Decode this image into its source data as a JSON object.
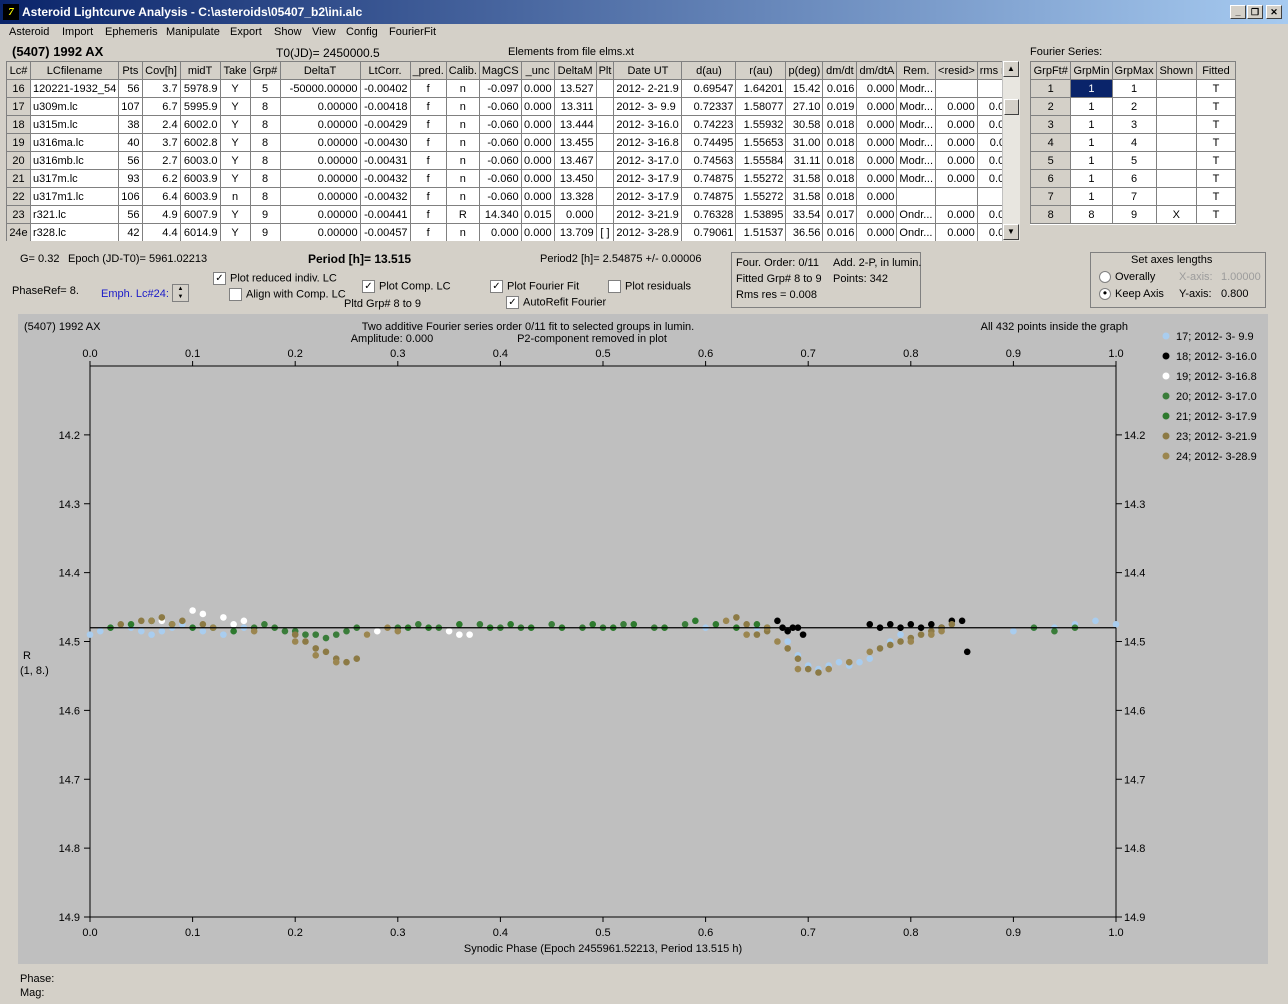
{
  "window": {
    "title": "Asteroid Lightcurve Analysis - C:\\asteroids\\05407_b2\\ini.alc"
  },
  "menu": [
    "Asteroid",
    "Import",
    "Ephemeris",
    "Manipulate",
    "Export",
    "Show",
    "View",
    "Config",
    "FourierFit"
  ],
  "header": {
    "asteroid": "(5407) 1992 AX",
    "t0": "T0(JD)= 2450000.5",
    "elements": "Elements from file elms.xt",
    "fourier_series": "Fourier Series:"
  },
  "lc_table": {
    "columns": [
      "Lc#",
      "LCfilename",
      "Pts",
      "Cov[h]",
      "midT",
      "Take",
      "Grp#",
      "DeltaT",
      "LtCorr.",
      "_pred.",
      "Calib.",
      "MagCS",
      "_unc",
      "DeltaM",
      "Plt",
      "Date UT",
      "d(au)",
      "r(au)",
      "p(deg)",
      "dm/dt",
      "dm/dtA",
      "Rem.",
      "<resid>",
      "rms res"
    ],
    "rows": [
      [
        "16",
        "120221-1932_54",
        "56",
        "3.7",
        "5978.9",
        "Y",
        "5",
        "-50000.00000",
        "-0.00402",
        "f",
        "n",
        "-0.097",
        "0.000",
        "13.527",
        "",
        "2012- 2-21.9",
        "0.69547",
        "1.64201",
        "15.42",
        "0.016",
        "0.000",
        "Modr...",
        "",
        ""
      ],
      [
        "17",
        "u309m.lc",
        "107",
        "6.7",
        "5995.9",
        "Y",
        "8",
        "0.00000",
        "-0.00418",
        "f",
        "n",
        "-0.060",
        "0.000",
        "13.311",
        "",
        "2012- 3- 9.9",
        "0.72337",
        "1.58077",
        "27.10",
        "0.019",
        "0.000",
        "Modr...",
        "0.000",
        "0.009"
      ],
      [
        "18",
        "u315m.lc",
        "38",
        "2.4",
        "6002.0",
        "Y",
        "8",
        "0.00000",
        "-0.00429",
        "f",
        "n",
        "-0.060",
        "0.000",
        "13.444",
        "",
        "2012- 3-16.0",
        "0.74223",
        "1.55932",
        "30.58",
        "0.018",
        "0.000",
        "Modr...",
        "0.000",
        "0.006"
      ],
      [
        "19",
        "u316ma.lc",
        "40",
        "3.7",
        "6002.8",
        "Y",
        "8",
        "0.00000",
        "-0.00430",
        "f",
        "n",
        "-0.060",
        "0.000",
        "13.455",
        "",
        "2012- 3-16.8",
        "0.74495",
        "1.55653",
        "31.00",
        "0.018",
        "0.000",
        "Modr...",
        "0.000",
        "0.011"
      ],
      [
        "20",
        "u316mb.lc",
        "56",
        "2.7",
        "6003.0",
        "Y",
        "8",
        "0.00000",
        "-0.00431",
        "f",
        "n",
        "-0.060",
        "0.000",
        "13.467",
        "",
        "2012- 3-17.0",
        "0.74563",
        "1.55584",
        "31.11",
        "0.018",
        "0.000",
        "Modr...",
        "0.000",
        "0.006"
      ],
      [
        "21",
        "u317m.lc",
        "93",
        "6.2",
        "6003.9",
        "Y",
        "8",
        "0.00000",
        "-0.00432",
        "f",
        "n",
        "-0.060",
        "0.000",
        "13.450",
        "",
        "2012- 3-17.9",
        "0.74875",
        "1.55272",
        "31.58",
        "0.018",
        "0.000",
        "Modr...",
        "0.000",
        "0.006"
      ],
      [
        "22",
        "u317m1.lc",
        "106",
        "6.4",
        "6003.9",
        "n",
        "8",
        "0.00000",
        "-0.00432",
        "f",
        "n",
        "-0.060",
        "0.000",
        "13.328",
        "",
        "2012- 3-17.9",
        "0.74875",
        "1.55272",
        "31.58",
        "0.018",
        "0.000",
        "",
        "",
        ""
      ],
      [
        "23",
        "r321.lc",
        "56",
        "4.9",
        "6007.9",
        "Y",
        "9",
        "0.00000",
        "-0.00441",
        "f",
        "R",
        "14.340",
        "0.015",
        "0.000",
        "",
        "2012- 3-21.9",
        "0.76328",
        "1.53895",
        "33.54",
        "0.017",
        "0.000",
        "Ondr...",
        "0.000",
        "0.010"
      ],
      [
        "24e",
        "r328.lc",
        "42",
        "4.4",
        "6014.9",
        "Y",
        "9",
        "0.00000",
        "-0.00457",
        "f",
        "n",
        "0.000",
        "0.000",
        "13.709",
        "[ ]",
        "2012- 3-28.9",
        "0.79061",
        "1.51537",
        "36.56",
        "0.016",
        "0.000",
        "Ondr...",
        "0.000",
        "0.010"
      ]
    ]
  },
  "fourier_table": {
    "columns": [
      "GrpFt#",
      "GrpMin",
      "GrpMax",
      "Shown",
      "Fitted"
    ],
    "rows": [
      [
        "1",
        "1",
        "1",
        "",
        "T"
      ],
      [
        "2",
        "1",
        "2",
        "",
        "T"
      ],
      [
        "3",
        "1",
        "3",
        "",
        "T"
      ],
      [
        "4",
        "1",
        "4",
        "",
        "T"
      ],
      [
        "5",
        "1",
        "5",
        "",
        "T"
      ],
      [
        "6",
        "1",
        "6",
        "",
        "T"
      ],
      [
        "7",
        "1",
        "7",
        "",
        "T"
      ],
      [
        "8",
        "8",
        "9",
        "X",
        "T"
      ]
    ]
  },
  "controls": {
    "g": "G= 0.32",
    "epoch": "Epoch (JD-T0)= 5961.02213",
    "period": "Period [h]= 13.515",
    "period2": "Period2 [h]= 2.54875 +/- 0.00006",
    "phaseref": "PhaseRef= 8.",
    "emph": "Emph. Lc#24:",
    "plot_reduced": "Plot reduced indiv. LC",
    "align_comp": "Align with Comp. LC",
    "plot_comp": "Plot Comp. LC",
    "pltd_grp": "Pltd Grp#  8  to   9",
    "plot_fourier": "Plot Fourier Fit",
    "autorefit": "AutoRefit Fourier",
    "plot_residuals": "Plot residuals",
    "four_order": "Four. Order:  0/11",
    "add2p": "Add. 2-P, in lumin.",
    "fitted_grp": "Fitted Grp# 8 to 9",
    "points": "Points: 342",
    "rms_res": "Rms res     = 0.008"
  },
  "axes_box": {
    "title": "Set axes lengths",
    "overally": "Overally",
    "keep_axis": "Keep Axis",
    "xaxis_label": "X-axis:",
    "xaxis_value": "1.00000",
    "yaxis_label": "Y-axis:",
    "yaxis_value": "0.800"
  },
  "chart_data": {
    "type": "scatter",
    "object_label": "(5407) 1992 AX",
    "title": "Two additive Fourier series order 0/11 fit to selected groups in lumin.",
    "subtitle_left": "Amplitude: 0.000",
    "subtitle_right": "P2-component removed in plot",
    "info": "All 432 points inside the graph",
    "xlabel": "Synodic Phase (Epoch 2455961.52213, Period 13.515 h)",
    "ylabel": "R",
    "ylabel2": "(1, 8.)",
    "xlim": [
      0.0,
      1.0
    ],
    "ylim": [
      14.1,
      14.9
    ],
    "y_inverted": true,
    "xticks": [
      "0.0",
      "0.1",
      "0.2",
      "0.3",
      "0.4",
      "0.5",
      "0.6",
      "0.7",
      "0.8",
      "0.9",
      "1.0"
    ],
    "yticks": [
      "14.2",
      "14.3",
      "14.4",
      "14.5",
      "14.6",
      "14.7",
      "14.8",
      "14.9"
    ],
    "fit_line": 14.48,
    "series": [
      {
        "name": "17; 2012- 3- 9.9",
        "color": "#a9cdef",
        "points": [
          [
            0.0,
            14.49
          ],
          [
            0.01,
            14.485
          ],
          [
            0.02,
            14.48
          ],
          [
            0.03,
            14.475
          ],
          [
            0.04,
            14.48
          ],
          [
            0.05,
            14.485
          ],
          [
            0.06,
            14.49
          ],
          [
            0.07,
            14.485
          ],
          [
            0.08,
            14.48
          ],
          [
            0.09,
            14.475
          ],
          [
            0.1,
            14.48
          ],
          [
            0.11,
            14.485
          ],
          [
            0.12,
            14.48
          ],
          [
            0.13,
            14.49
          ],
          [
            0.14,
            14.485
          ],
          [
            0.15,
            14.48
          ],
          [
            0.6,
            14.48
          ],
          [
            0.65,
            14.48
          ],
          [
            0.68,
            14.5
          ],
          [
            0.69,
            14.52
          ],
          [
            0.7,
            14.535
          ],
          [
            0.71,
            14.54
          ],
          [
            0.72,
            14.535
          ],
          [
            0.73,
            14.53
          ],
          [
            0.74,
            14.535
          ],
          [
            0.75,
            14.53
          ],
          [
            0.76,
            14.525
          ],
          [
            0.77,
            14.51
          ],
          [
            0.78,
            14.5
          ],
          [
            0.79,
            14.49
          ],
          [
            0.9,
            14.485
          ],
          [
            0.92,
            14.48
          ],
          [
            0.94,
            14.48
          ],
          [
            0.96,
            14.475
          ],
          [
            0.98,
            14.47
          ],
          [
            1.0,
            14.475
          ]
        ]
      },
      {
        "name": "18; 2012- 3-16.0",
        "color": "#000000",
        "points": [
          [
            0.67,
            14.47
          ],
          [
            0.675,
            14.48
          ],
          [
            0.68,
            14.485
          ],
          [
            0.685,
            14.48
          ],
          [
            0.69,
            14.48
          ],
          [
            0.695,
            14.49
          ],
          [
            0.76,
            14.475
          ],
          [
            0.77,
            14.48
          ],
          [
            0.78,
            14.475
          ],
          [
            0.79,
            14.48
          ],
          [
            0.8,
            14.475
          ],
          [
            0.81,
            14.48
          ],
          [
            0.82,
            14.475
          ],
          [
            0.83,
            14.48
          ],
          [
            0.84,
            14.47
          ],
          [
            0.85,
            14.47
          ],
          [
            0.855,
            14.515
          ]
        ]
      },
      {
        "name": "19; 2012- 3-16.8",
        "color": "#ffffff",
        "points": [
          [
            0.07,
            14.47
          ],
          [
            0.1,
            14.455
          ],
          [
            0.11,
            14.46
          ],
          [
            0.13,
            14.465
          ],
          [
            0.14,
            14.475
          ],
          [
            0.15,
            14.47
          ],
          [
            0.27,
            14.49
          ],
          [
            0.28,
            14.485
          ],
          [
            0.35,
            14.485
          ],
          [
            0.36,
            14.49
          ],
          [
            0.37,
            14.49
          ]
        ]
      },
      {
        "name": "20; 2012- 3-17.0",
        "color": "#3a7d3a",
        "points": [
          [
            0.16,
            14.48
          ],
          [
            0.17,
            14.475
          ],
          [
            0.18,
            14.48
          ],
          [
            0.19,
            14.485
          ],
          [
            0.2,
            14.485
          ],
          [
            0.21,
            14.49
          ],
          [
            0.22,
            14.49
          ],
          [
            0.23,
            14.495
          ],
          [
            0.24,
            14.49
          ],
          [
            0.25,
            14.485
          ],
          [
            0.26,
            14.48
          ],
          [
            0.3,
            14.48
          ],
          [
            0.32,
            14.475
          ],
          [
            0.34,
            14.48
          ],
          [
            0.38,
            14.475
          ],
          [
            0.4,
            14.48
          ],
          [
            0.42,
            14.48
          ],
          [
            0.45,
            14.475
          ],
          [
            0.48,
            14.48
          ],
          [
            0.5,
            14.48
          ],
          [
            0.52,
            14.475
          ],
          [
            0.55,
            14.48
          ],
          [
            0.58,
            14.475
          ],
          [
            0.92,
            14.48
          ],
          [
            0.94,
            14.485
          ],
          [
            0.96,
            14.48
          ]
        ]
      },
      {
        "name": "21; 2012- 3-17.9",
        "color": "#2e7a2e",
        "points": [
          [
            0.02,
            14.48
          ],
          [
            0.04,
            14.475
          ],
          [
            0.06,
            14.47
          ],
          [
            0.08,
            14.475
          ],
          [
            0.1,
            14.48
          ],
          [
            0.12,
            14.48
          ],
          [
            0.14,
            14.485
          ],
          [
            0.31,
            14.48
          ],
          [
            0.33,
            14.48
          ],
          [
            0.36,
            14.475
          ],
          [
            0.39,
            14.48
          ],
          [
            0.41,
            14.475
          ],
          [
            0.43,
            14.48
          ],
          [
            0.46,
            14.48
          ],
          [
            0.49,
            14.475
          ],
          [
            0.51,
            14.48
          ],
          [
            0.53,
            14.475
          ],
          [
            0.56,
            14.48
          ],
          [
            0.59,
            14.47
          ],
          [
            0.61,
            14.475
          ],
          [
            0.63,
            14.48
          ],
          [
            0.65,
            14.475
          ],
          [
            0.66,
            14.48
          ]
        ]
      },
      {
        "name": "23; 2012- 3-21.9",
        "color": "#8c7a45",
        "points": [
          [
            0.03,
            14.475
          ],
          [
            0.05,
            14.47
          ],
          [
            0.07,
            14.465
          ],
          [
            0.09,
            14.47
          ],
          [
            0.11,
            14.475
          ],
          [
            0.2,
            14.49
          ],
          [
            0.21,
            14.5
          ],
          [
            0.22,
            14.51
          ],
          [
            0.23,
            14.515
          ],
          [
            0.24,
            14.525
          ],
          [
            0.25,
            14.53
          ],
          [
            0.26,
            14.525
          ],
          [
            0.63,
            14.465
          ],
          [
            0.64,
            14.475
          ],
          [
            0.65,
            14.49
          ],
          [
            0.66,
            14.485
          ],
          [
            0.68,
            14.51
          ],
          [
            0.69,
            14.525
          ],
          [
            0.7,
            14.54
          ],
          [
            0.71,
            14.545
          ],
          [
            0.77,
            14.51
          ],
          [
            0.78,
            14.505
          ],
          [
            0.79,
            14.5
          ],
          [
            0.8,
            14.495
          ],
          [
            0.81,
            14.49
          ],
          [
            0.82,
            14.485
          ],
          [
            0.83,
            14.48
          ],
          [
            0.84,
            14.475
          ]
        ]
      },
      {
        "name": "24; 2012- 3-28.9",
        "color": "#9b8650",
        "points": [
          [
            0.06,
            14.47
          ],
          [
            0.08,
            14.475
          ],
          [
            0.12,
            14.48
          ],
          [
            0.16,
            14.485
          ],
          [
            0.2,
            14.5
          ],
          [
            0.22,
            14.52
          ],
          [
            0.24,
            14.53
          ],
          [
            0.27,
            14.49
          ],
          [
            0.29,
            14.48
          ],
          [
            0.3,
            14.485
          ],
          [
            0.62,
            14.47
          ],
          [
            0.64,
            14.49
          ],
          [
            0.66,
            14.48
          ],
          [
            0.67,
            14.5
          ],
          [
            0.69,
            14.54
          ],
          [
            0.72,
            14.54
          ],
          [
            0.74,
            14.53
          ],
          [
            0.76,
            14.515
          ],
          [
            0.8,
            14.5
          ],
          [
            0.82,
            14.49
          ],
          [
            0.83,
            14.485
          ]
        ]
      }
    ]
  },
  "status": {
    "phase": "Phase:",
    "mag": "Mag:"
  }
}
